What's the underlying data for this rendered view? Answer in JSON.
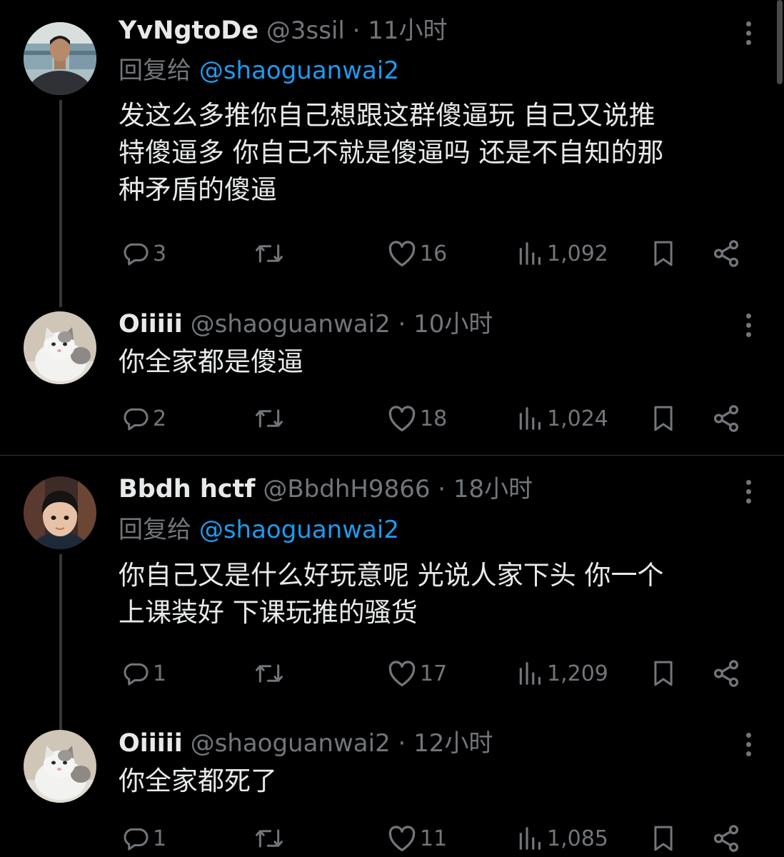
{
  "threads": [
    {
      "tweets": [
        {
          "name": "YvNgtoDe",
          "handle": "@3ssil",
          "time": "11小时",
          "reply_label": "回复给",
          "reply_to": "@shaoguanwai2",
          "text": "发这么多推你自己想跟这群傻逼玩 自己又说推\n特傻逼多 你自己不就是傻逼吗 还是不自知的那\n种矛盾的傻逼",
          "replies": "3",
          "retweets": "",
          "likes": "16",
          "views": "1,092",
          "avatar": "man-avatar"
        },
        {
          "name": "Oiiiii",
          "handle": "@shaoguanwai2",
          "time": "10小时",
          "text": "你全家都是傻逼",
          "replies": "2",
          "retweets": "",
          "likes": "18",
          "views": "1,024",
          "avatar": "cat-avatar"
        }
      ]
    },
    {
      "tweets": [
        {
          "name": "Bbdh hctf",
          "handle": "@BbdhH9866",
          "time": "18小时",
          "reply_label": "回复给",
          "reply_to": "@shaoguanwai2",
          "text": "你自己又是什么好玩意呢 光说人家下头 你一个\n上课装好 下课玩推的骚货",
          "replies": "1",
          "retweets": "",
          "likes": "17",
          "views": "1,209",
          "avatar": "boy-avatar"
        },
        {
          "name": "Oiiiii",
          "handle": "@shaoguanwai2",
          "time": "12小时",
          "text": "你全家都死了",
          "replies": "1",
          "retweets": "",
          "likes": "11",
          "views": "1,085",
          "avatar": "cat-avatar"
        }
      ]
    }
  ],
  "icons": {
    "reply": "reply-icon",
    "retweet": "retweet-icon",
    "like": "heart-icon",
    "views": "views-icon",
    "bookmark": "bookmark-icon",
    "share": "share-icon",
    "more": "more-icon"
  },
  "colors": {
    "background": "#000000",
    "text": "#e7e9ea",
    "secondary": "#71767b",
    "link": "#1d9bf0",
    "divider": "#2f3336"
  }
}
